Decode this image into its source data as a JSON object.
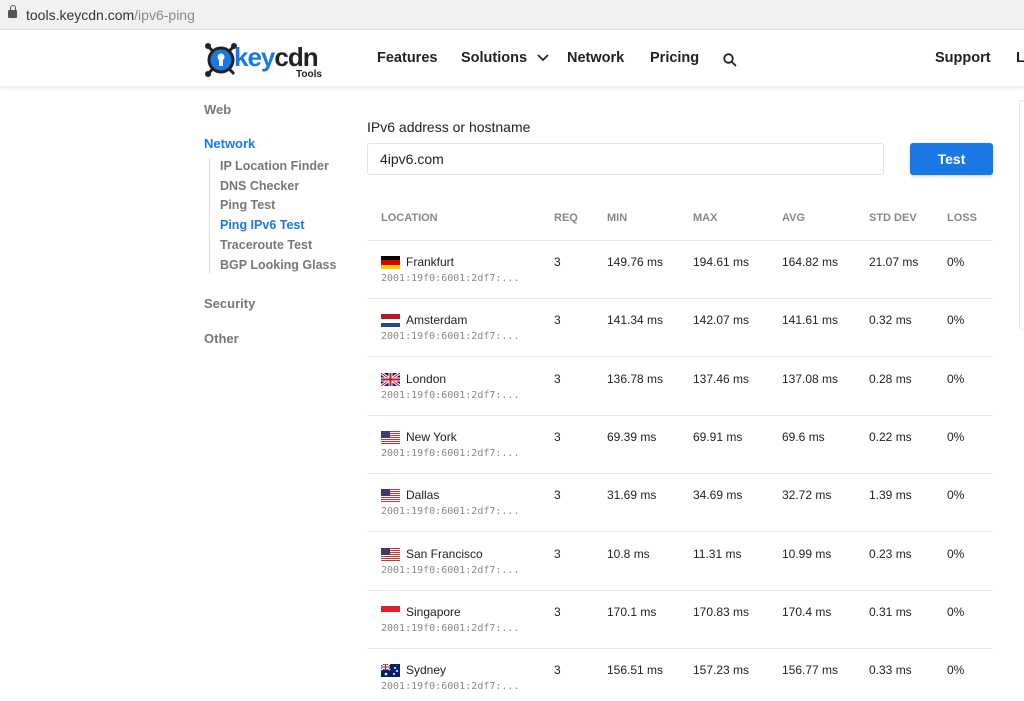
{
  "browser": {
    "url_host": "tools.keycdn.com",
    "url_path": "/ipv6-ping"
  },
  "header": {
    "logo_text_key": "key",
    "logo_text_cdn": "cdn",
    "logo_sub": "Tools",
    "nav": [
      "Features",
      "Solutions",
      "Network",
      "Pricing"
    ],
    "support": "Support",
    "login": "Login"
  },
  "sidebar": {
    "web": "Web",
    "network": "Network",
    "security": "Security",
    "other": "Other",
    "network_items": [
      "IP Location Finder",
      "DNS Checker",
      "Ping Test",
      "Ping IPv6 Test",
      "Traceroute Test",
      "BGP Looking Glass"
    ],
    "active_item": "Ping IPv6 Test"
  },
  "form": {
    "label": "IPv6 address or hostname",
    "value": "4ipv6.com",
    "button": "Test"
  },
  "table": {
    "headers": [
      "LOCATION",
      "REQ",
      "MIN",
      "MAX",
      "AVG",
      "STD DEV",
      "LOSS"
    ],
    "rows": [
      {
        "flag": "de",
        "location": "Frankfurt",
        "ip": "2001:19f0:6001:2df7:...",
        "req": "3",
        "min": "149.76 ms",
        "max": "194.61 ms",
        "avg": "164.82 ms",
        "std": "21.07 ms",
        "loss": "0%"
      },
      {
        "flag": "nl",
        "location": "Amsterdam",
        "ip": "2001:19f0:6001:2df7:...",
        "req": "3",
        "min": "141.34 ms",
        "max": "142.07 ms",
        "avg": "141.61 ms",
        "std": "0.32 ms",
        "loss": "0%"
      },
      {
        "flag": "gb",
        "location": "London",
        "ip": "2001:19f0:6001:2df7:...",
        "req": "3",
        "min": "136.78 ms",
        "max": "137.46 ms",
        "avg": "137.08 ms",
        "std": "0.28 ms",
        "loss": "0%"
      },
      {
        "flag": "us",
        "location": "New York",
        "ip": "2001:19f0:6001:2df7:...",
        "req": "3",
        "min": "69.39 ms",
        "max": "69.91 ms",
        "avg": "69.6 ms",
        "std": "0.22 ms",
        "loss": "0%"
      },
      {
        "flag": "us",
        "location": "Dallas",
        "ip": "2001:19f0:6001:2df7:...",
        "req": "3",
        "min": "31.69 ms",
        "max": "34.69 ms",
        "avg": "32.72 ms",
        "std": "1.39 ms",
        "loss": "0%"
      },
      {
        "flag": "us",
        "location": "San Francisco",
        "ip": "2001:19f0:6001:2df7:...",
        "req": "3",
        "min": "10.8 ms",
        "max": "11.31 ms",
        "avg": "10.99 ms",
        "std": "0.23 ms",
        "loss": "0%"
      },
      {
        "flag": "sg",
        "location": "Singapore",
        "ip": "2001:19f0:6001:2df7:...",
        "req": "3",
        "min": "170.1 ms",
        "max": "170.83 ms",
        "avg": "170.4 ms",
        "std": "0.31 ms",
        "loss": "0%"
      },
      {
        "flag": "au",
        "location": "Sydney",
        "ip": "2001:19f0:6001:2df7:...",
        "req": "3",
        "min": "156.51 ms",
        "max": "157.23 ms",
        "avg": "156.77 ms",
        "std": "0.33 ms",
        "loss": "0%"
      }
    ]
  },
  "colors": {
    "accent": "#1a78e6"
  }
}
